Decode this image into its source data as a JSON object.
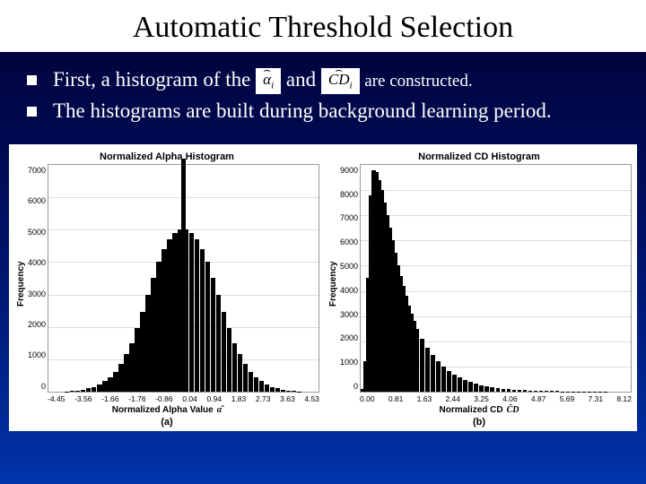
{
  "title": "Automatic Threshold Selection",
  "bullets": [
    {
      "pre": "First, a histogram of the ",
      "sym1": "α",
      "sub1": "i",
      "mid": " and ",
      "sym2": "CD",
      "sub2": "i",
      "post": "are constructed."
    },
    {
      "full": "The histograms are built during background learning period."
    }
  ],
  "chart_data": [
    {
      "type": "bar",
      "title": "Normalized Alpha Histogram",
      "ylabel": "Frequency",
      "xlabel": "Normalized Alpha Value",
      "xlabel_sym": "α̂",
      "xlabel_sub": "i",
      "sub_label": "(a)",
      "yticks": [
        "7000",
        "6000",
        "5000",
        "4000",
        "3000",
        "2000",
        "1000",
        "0"
      ],
      "xticks": [
        "-4.45",
        "-3.56",
        "-1.66",
        "-1.76",
        "-0.86",
        "0.04",
        "0.94",
        "1.83",
        "2.73",
        "3.63",
        "4.53"
      ],
      "ylim": 7000,
      "bars": [
        {
          "x": 0.0,
          "y": 0
        },
        {
          "x": 0.02,
          "y": 0
        },
        {
          "x": 0.04,
          "y": 0
        },
        {
          "x": 0.06,
          "y": 10
        },
        {
          "x": 0.08,
          "y": 20
        },
        {
          "x": 0.1,
          "y": 40
        },
        {
          "x": 0.12,
          "y": 60
        },
        {
          "x": 0.14,
          "y": 100
        },
        {
          "x": 0.16,
          "y": 150
        },
        {
          "x": 0.18,
          "y": 220
        },
        {
          "x": 0.2,
          "y": 320
        },
        {
          "x": 0.22,
          "y": 450
        },
        {
          "x": 0.24,
          "y": 620
        },
        {
          "x": 0.26,
          "y": 850
        },
        {
          "x": 0.28,
          "y": 1150
        },
        {
          "x": 0.3,
          "y": 1500
        },
        {
          "x": 0.32,
          "y": 1950
        },
        {
          "x": 0.34,
          "y": 2450
        },
        {
          "x": 0.36,
          "y": 3000
        },
        {
          "x": 0.38,
          "y": 3500
        },
        {
          "x": 0.4,
          "y": 4000
        },
        {
          "x": 0.42,
          "y": 4400
        },
        {
          "x": 0.44,
          "y": 4700
        },
        {
          "x": 0.46,
          "y": 4900
        },
        {
          "x": 0.48,
          "y": 5000
        },
        {
          "x": 0.49,
          "y": 7200
        },
        {
          "x": 0.5,
          "y": 5000
        },
        {
          "x": 0.52,
          "y": 4900
        },
        {
          "x": 0.54,
          "y": 4700
        },
        {
          "x": 0.56,
          "y": 4400
        },
        {
          "x": 0.58,
          "y": 4000
        },
        {
          "x": 0.6,
          "y": 3500
        },
        {
          "x": 0.62,
          "y": 3000
        },
        {
          "x": 0.64,
          "y": 2450
        },
        {
          "x": 0.66,
          "y": 1950
        },
        {
          "x": 0.68,
          "y": 1500
        },
        {
          "x": 0.7,
          "y": 1150
        },
        {
          "x": 0.72,
          "y": 850
        },
        {
          "x": 0.74,
          "y": 620
        },
        {
          "x": 0.76,
          "y": 450
        },
        {
          "x": 0.78,
          "y": 320
        },
        {
          "x": 0.8,
          "y": 220
        },
        {
          "x": 0.82,
          "y": 150
        },
        {
          "x": 0.84,
          "y": 100
        },
        {
          "x": 0.86,
          "y": 60
        },
        {
          "x": 0.88,
          "y": 40
        },
        {
          "x": 0.9,
          "y": 20
        },
        {
          "x": 0.92,
          "y": 10
        },
        {
          "x": 0.94,
          "y": 0
        },
        {
          "x": 0.96,
          "y": 0
        },
        {
          "x": 0.98,
          "y": 0
        }
      ]
    },
    {
      "type": "bar",
      "title": "Normalized CD Histogram",
      "ylabel": "Frequency",
      "xlabel": "Normalized CD",
      "xlabel_sym": "ĈD",
      "xlabel_sub": "i",
      "sub_label": "(b)",
      "yticks": [
        "9000",
        "8000",
        "7000",
        "6000",
        "5000",
        "4000",
        "3000",
        "2000",
        "1000",
        "0"
      ],
      "xticks": [
        "0.00",
        "0.81",
        "1.63",
        "2.44",
        "3.25",
        "4.06",
        "4.87",
        "5.69",
        "7.31",
        "8.12"
      ],
      "ylim": 9000,
      "bars": [
        {
          "x": 0.0,
          "y": 100
        },
        {
          "x": 0.01,
          "y": 1200
        },
        {
          "x": 0.02,
          "y": 4500
        },
        {
          "x": 0.03,
          "y": 7800
        },
        {
          "x": 0.04,
          "y": 8800
        },
        {
          "x": 0.05,
          "y": 8700
        },
        {
          "x": 0.06,
          "y": 8400
        },
        {
          "x": 0.07,
          "y": 8000
        },
        {
          "x": 0.08,
          "y": 7500
        },
        {
          "x": 0.09,
          "y": 7000
        },
        {
          "x": 0.1,
          "y": 6500
        },
        {
          "x": 0.11,
          "y": 6000
        },
        {
          "x": 0.12,
          "y": 5500
        },
        {
          "x": 0.13,
          "y": 5000
        },
        {
          "x": 0.14,
          "y": 4600
        },
        {
          "x": 0.15,
          "y": 4200
        },
        {
          "x": 0.16,
          "y": 3800
        },
        {
          "x": 0.17,
          "y": 3400
        },
        {
          "x": 0.18,
          "y": 3100
        },
        {
          "x": 0.19,
          "y": 2800
        },
        {
          "x": 0.2,
          "y": 2500
        },
        {
          "x": 0.22,
          "y": 2100
        },
        {
          "x": 0.24,
          "y": 1750
        },
        {
          "x": 0.26,
          "y": 1450
        },
        {
          "x": 0.28,
          "y": 1200
        },
        {
          "x": 0.3,
          "y": 1000
        },
        {
          "x": 0.32,
          "y": 820
        },
        {
          "x": 0.34,
          "y": 680
        },
        {
          "x": 0.36,
          "y": 560
        },
        {
          "x": 0.38,
          "y": 460
        },
        {
          "x": 0.4,
          "y": 380
        },
        {
          "x": 0.42,
          "y": 310
        },
        {
          "x": 0.44,
          "y": 260
        },
        {
          "x": 0.46,
          "y": 210
        },
        {
          "x": 0.48,
          "y": 175
        },
        {
          "x": 0.5,
          "y": 145
        },
        {
          "x": 0.52,
          "y": 120
        },
        {
          "x": 0.54,
          "y": 100
        },
        {
          "x": 0.56,
          "y": 82
        },
        {
          "x": 0.58,
          "y": 68
        },
        {
          "x": 0.6,
          "y": 56
        },
        {
          "x": 0.62,
          "y": 46
        },
        {
          "x": 0.64,
          "y": 38
        },
        {
          "x": 0.66,
          "y": 31
        },
        {
          "x": 0.68,
          "y": 26
        },
        {
          "x": 0.7,
          "y": 21
        },
        {
          "x": 0.72,
          "y": 17
        },
        {
          "x": 0.74,
          "y": 14
        },
        {
          "x": 0.76,
          "y": 12
        },
        {
          "x": 0.78,
          "y": 10
        },
        {
          "x": 0.8,
          "y": 8
        },
        {
          "x": 0.82,
          "y": 7
        },
        {
          "x": 0.84,
          "y": 5
        },
        {
          "x": 0.86,
          "y": 4
        },
        {
          "x": 0.88,
          "y": 3
        },
        {
          "x": 0.9,
          "y": 3
        },
        {
          "x": 0.92,
          "y": 2
        },
        {
          "x": 0.94,
          "y": 2
        },
        {
          "x": 0.96,
          "y": 1
        },
        {
          "x": 0.98,
          "y": 1
        }
      ]
    }
  ]
}
